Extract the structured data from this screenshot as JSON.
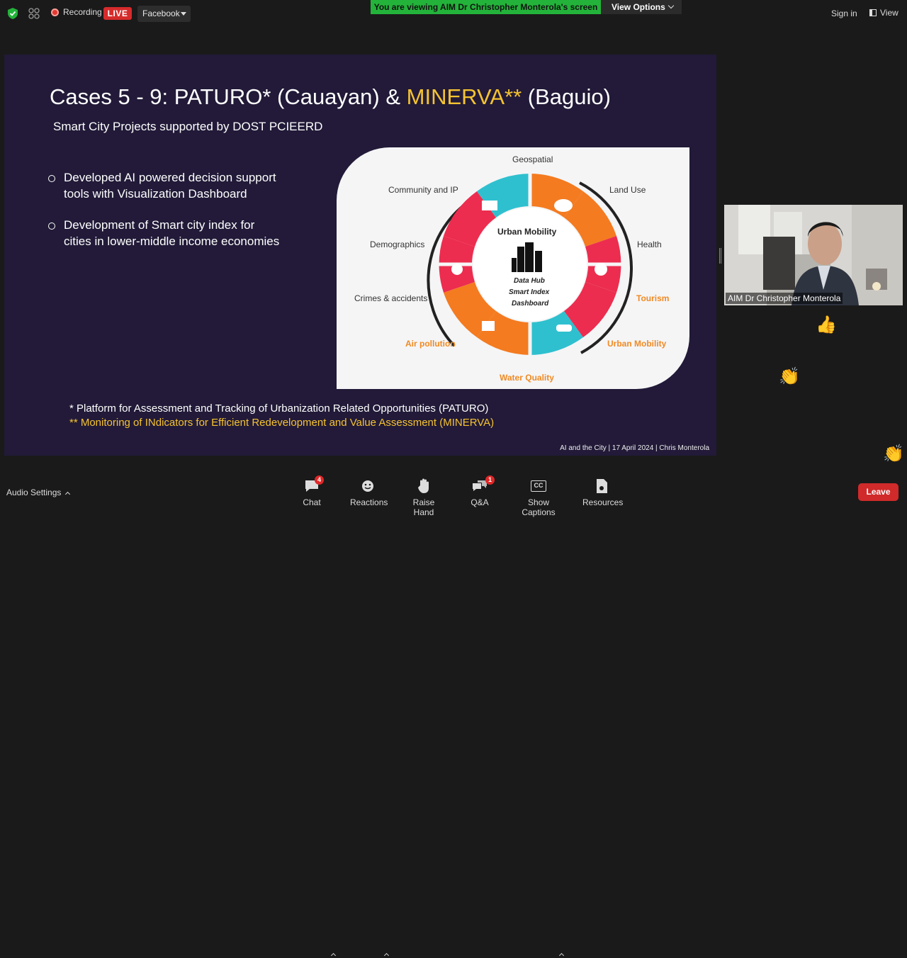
{
  "topbar": {
    "recording_label": "Recording",
    "live_label": "LIVE",
    "stream_target": "Facebook",
    "viewing_banner": "You are viewing AIM Dr Christopher Monterola's screen",
    "view_options_label": "View Options",
    "sign_in_label": "Sign in",
    "view_label": "View"
  },
  "slide": {
    "title_prefix": "Cases 5 - 9: PATURO* (Cauayan) & ",
    "title_highlight": "MINERVA**",
    "title_suffix": " (Baguio)",
    "subtitle": "Smart City Projects supported by DOST PCIEERD",
    "bullets": [
      "Developed AI powered decision support tools with Visualization Dashboard",
      "Development of Smart city index for cities in lower-middle income economies"
    ],
    "diagram": {
      "center_title": "Urban Mobility",
      "center_line1": "Data Hub",
      "center_line2": "Smart Index",
      "center_line3": "Dashboard",
      "labels": {
        "geospatial": "Geospatial",
        "land_use": "Land Use",
        "health": "Health",
        "tourism": "Tourism",
        "urban_mobility": "Urban Mobility",
        "water_quality": "Water Quality",
        "air_pollution": "Air pollution",
        "crimes": "Crimes & accidents",
        "demographics": "Demographics",
        "community": "Community and IP"
      },
      "colors": {
        "teal": "#2fc0cf",
        "orange": "#f47b20",
        "red": "#ec2d4f",
        "dark": "#222222"
      }
    },
    "footnote_paturo": "* Platform for Assessment and Tracking of Urbanization Related Opportunities (PATURO)",
    "footnote_minerva": "** Monitoring of INdicators for Efficient Redevelopment and Value Assessment (MINERVA)",
    "footer": "AI and the City  |  17 April 2024  |  Chris Monterola"
  },
  "video": {
    "participant_name": "AIM Dr Christopher Monterola"
  },
  "reactions": {
    "thumbs": "👍",
    "clap1": "👏",
    "clap2": "👏"
  },
  "bottombar": {
    "audio_settings": "Audio Settings",
    "chat_label": "Chat",
    "chat_badge": "4",
    "reactions_label": "Reactions",
    "raise_hand_label": "Raise Hand",
    "qa_label": "Q&A",
    "qa_badge": "1",
    "captions_label": "Show Captions",
    "captions_icon_text": "CC",
    "resources_label": "Resources",
    "leave_label": "Leave"
  }
}
